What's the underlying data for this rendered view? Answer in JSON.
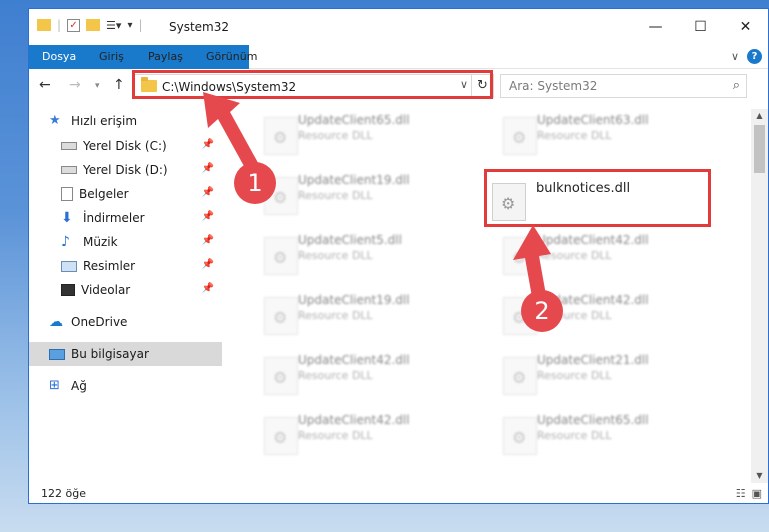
{
  "window": {
    "title": "System32",
    "controls": [
      "minimize-icon",
      "maximize-icon",
      "close-icon"
    ]
  },
  "ribbon": {
    "tabs": [
      "Dosya",
      "Giriş",
      "Paylaş",
      "Görünüm"
    ]
  },
  "address": {
    "path": "C:\\Windows\\System32"
  },
  "search": {
    "placeholder": "Ara: System32"
  },
  "sidebar": {
    "items": [
      {
        "label": "Hızlı erişim",
        "icon": "star-icon"
      },
      {
        "label": "Yerel Disk (C:)",
        "icon": "drive-icon",
        "pinned": true
      },
      {
        "label": "Yerel Disk (D:)",
        "icon": "drive-icon",
        "pinned": true
      },
      {
        "label": "Belgeler",
        "icon": "documents-icon",
        "pinned": true
      },
      {
        "label": "İndirmeler",
        "icon": "download-icon",
        "pinned": true
      },
      {
        "label": "Müzik",
        "icon": "music-icon",
        "pinned": true
      },
      {
        "label": "Resimler",
        "icon": "pictures-icon",
        "pinned": true
      },
      {
        "label": "Videolar",
        "icon": "video-icon",
        "pinned": true
      },
      {
        "label": "OneDrive",
        "icon": "cloud-icon"
      },
      {
        "label": "Bu bilgisayar",
        "icon": "computer-icon",
        "selected": true
      },
      {
        "label": "Ağ",
        "icon": "network-icon"
      }
    ]
  },
  "files": {
    "left": [
      {
        "name": "UpdateClient65.dll",
        "type": "Resource DLL"
      },
      {
        "name": "UpdateClient19.dll",
        "type": "Resource DLL"
      },
      {
        "name": "UpdateClient5.dll",
        "type": "Resource DLL"
      },
      {
        "name": "UpdateClient19.dll",
        "type": "Resource DLL"
      },
      {
        "name": "UpdateClient42.dll",
        "type": "Resource DLL"
      },
      {
        "name": "UpdateClient42.dll",
        "type": "Resource DLL"
      }
    ],
    "right": [
      {
        "name": "UpdateClient63.dll",
        "type": "Resource DLL"
      },
      {
        "name": "bulknotices.dll",
        "type": ""
      },
      {
        "name": "UpdateClient42.dll",
        "type": "Resource DLL"
      },
      {
        "name": "UpdateClient42.dll",
        "type": "Resource DLL"
      },
      {
        "name": "UpdateClient21.dll",
        "type": "Resource DLL"
      },
      {
        "name": "UpdateClient65.dll",
        "type": "Resource DLL"
      }
    ]
  },
  "status": {
    "count": "122 öğe"
  },
  "annotations": {
    "badge1": "1",
    "badge2": "2",
    "color": "#e23b3b"
  }
}
